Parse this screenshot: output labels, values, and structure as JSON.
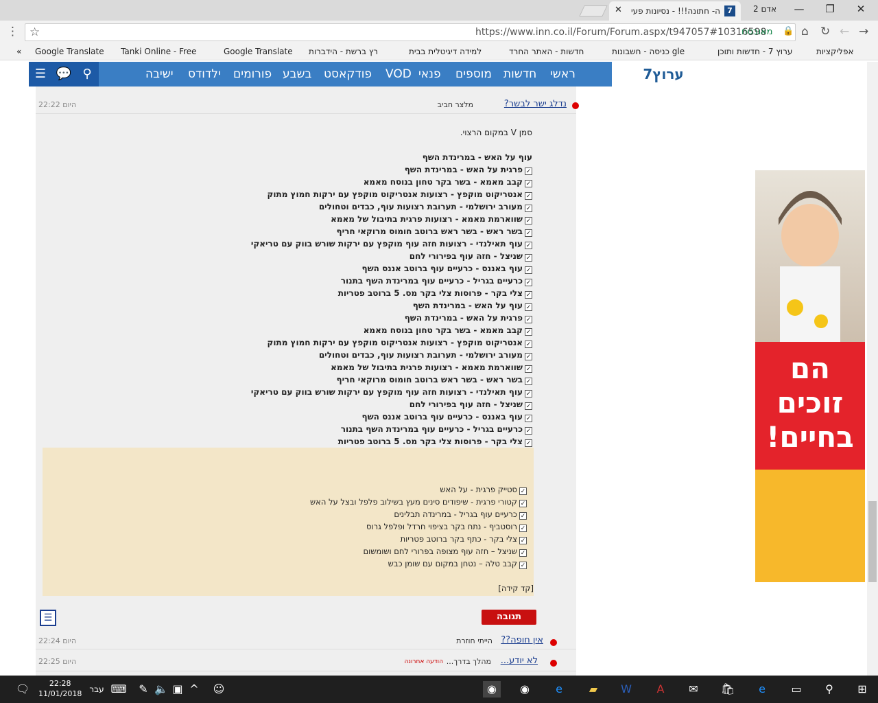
{
  "browser": {
    "tab_title": "ה- חתונה!!! - נסיונות פעי",
    "tab_favicon": "7",
    "profile_label": "אדם 2",
    "url": "https://www.inn.co.il/Forum/Forum.aspx/t947057#10316598",
    "secure_label": "מאובטח"
  },
  "bookmarks": [
    "אפליקציות",
    "ערוץ 7 - חדשות ותוכן",
    "כניסה - חשבונות gle",
    "חדשות - האתר החרד",
    "למידה דיגיטלית בבית",
    "רץ ברשת - הידברות",
    "Google Translate",
    "Tanki Online - Free M",
    "Google Translate"
  ],
  "site": {
    "logo": "ערוץ7",
    "nav": [
      "ראשי",
      "חדשות",
      "מוספים",
      "פנאי",
      "VOD",
      "פודקאסט",
      "בשבע",
      "פורומים",
      "ילדודס",
      "ישיבה"
    ]
  },
  "post": {
    "title": "נדלג ישר לבשר?",
    "author": "מלצר חביב",
    "time": "היום 22:22",
    "intro": "סמן V במקום הרצוי.",
    "items": [
      "עוף על האש - במרינדת השף",
      "פרגית על האש - במרינדת השף",
      "קבב מאמא - בשר בקר טחון בנוסח מאמא",
      "אנטריקוט מוקפץ - רצועות אנטריקוט מוקפץ עם ירקות חמוץ מתוק",
      "מעורב ירושלמי - תערובת רצועות עוף, כבדים וטחולים",
      "שווארמת מאמא - רצועות פרגית בתיבול של מאמא",
      "בשר ראש - בשר ראש ברוטב חומוס מרוקאי חריף",
      "עוף תאילנדי - רצועות חזה עוף מוקפץ עם ירקות שורש בווק עם טריאקי",
      "שניצל - חזה עוף בפירורי לחם",
      "עוף באננס - כרעיים עוף ברוטב אננס השף",
      "כרעיים בגריל - כרעיים עוף במרינדת השף בתנור",
      "צלי בקר - פרוסות צלי בקר מס. 5 ברוטב פטריות",
      "עוף על האש - במרינדת השף",
      "פרגית על האש - במרינדת השף",
      "קבב מאמא - בשר בקר טחון בנוסח מאמא",
      "אנטריקוט מוקפץ - רצועות אנטריקוט מוקפץ עם ירקות חמוץ מתוק",
      "מעורב ירושלמי - תערובת רצועות עוף, כבדים וטחולים",
      "שווארמת מאמא - רצועות פרגית בתיבול של מאמא",
      "בשר ראש - בשר ראש ברוטב חומוס מרוקאי חריף",
      "עוף תאילנדי - רצועות חזה עוף מוקפץ עם ירקות שורש בווק עם טריאקי",
      "שניצל - חזה עוף בפירורי לחם",
      "עוף באננס - כרעיים עוף ברוטב אננס השף",
      "כרעיים בגריל - כרעיים עוף במרינדת השף בתנור",
      "צלי בקר - פרוסות צלי בקר מס. 5 ברוטב פטריות"
    ],
    "quote_items": [
      "סטייק פרגית - על האש",
      "קטורי פרגית - שיפודים סינים מעץ בשילוב פלפל ובצל על האש",
      "כרעיים עוף בגריל - במרינדה תבלינים",
      "רוסטביף - נתח בקר בציפוי חרדל ופלפל גרוס",
      "צלי בקר - כתף בקר ברוטב פטריות",
      "שניצל – חזה עוף מצופה בפרורי לחם ושומשום",
      "קבב טלה – נטחן במקום עם שומן כבש"
    ],
    "quote_footer": "[קד קידה]",
    "reply_label": "תגובה"
  },
  "threads": [
    {
      "title": "אין חופה??",
      "author": "הייתי חוזרת",
      "time": "היום 22:24"
    },
    {
      "title": "לא יודע...",
      "author": "מהלך בדרך...",
      "badge": "הודעה אחרונה",
      "time": "היום 22:25"
    }
  ],
  "ad": {
    "headline": "הם זוכים בחיים!"
  },
  "taskbar": {
    "time": "22:28",
    "date": "11/01/2018",
    "lang": "עבר"
  }
}
